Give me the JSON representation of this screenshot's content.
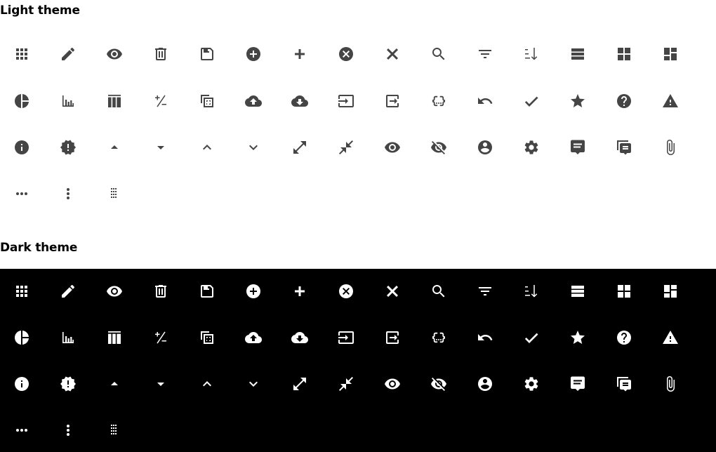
{
  "sections": [
    {
      "id": "light",
      "title": "Light theme",
      "background": "#ffffff",
      "icon_color": "#454545"
    },
    {
      "id": "dark",
      "title": "Dark theme",
      "background": "#000000",
      "icon_color": "#ffffff"
    }
  ],
  "icons": [
    "apps-icon",
    "edit-icon",
    "visibility-icon",
    "delete-icon",
    "save-icon",
    "add-circle-icon",
    "add-icon",
    "cancel-icon",
    "close-icon",
    "search-icon",
    "filter-list-icon",
    "sort-icon",
    "view-stream-icon",
    "view-module-icon",
    "dashboard-icon",
    "pie-chart-icon",
    "bar-chart-icon",
    "view-column-icon",
    "plus-minus-icon",
    "select-copy-icon",
    "cloud-upload-icon",
    "cloud-download-icon",
    "input-icon",
    "exit-to-app-icon",
    "data-object-icon",
    "undo-icon",
    "check-icon",
    "star-icon",
    "help-icon",
    "warning-icon",
    "info-icon",
    "new-releases-icon",
    "arrow-drop-up-icon",
    "arrow-drop-down-icon",
    "expand-less-icon",
    "expand-more-icon",
    "open-in-full-icon",
    "close-fullscreen-icon",
    "visibility-on-icon",
    "visibility-off-icon",
    "account-circle-icon",
    "settings-icon",
    "comment-icon",
    "forum-icon",
    "attach-file-icon",
    "more-horiz-icon",
    "more-vert-icon",
    "drag-indicator-icon"
  ]
}
